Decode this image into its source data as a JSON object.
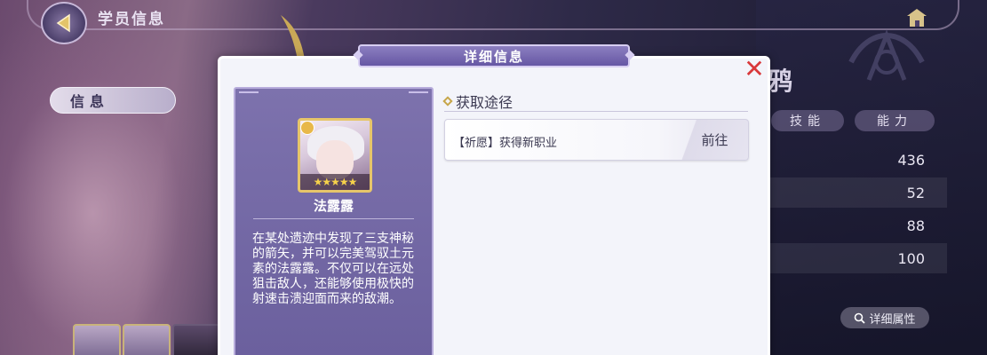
{
  "top": {
    "title": "学员信息"
  },
  "left_tab": {
    "label": "信息"
  },
  "background": {
    "crow_title": "鸦",
    "stat_tabs": [
      "技能",
      "能力"
    ],
    "stat_values": [
      "436",
      "52",
      "88",
      "100"
    ],
    "detail_attr_label": "详细属性"
  },
  "modal": {
    "header": "详细信息",
    "character": {
      "name": "法露露",
      "stars": "★★★★★",
      "description": "在某处遗迹中发现了三支神秘的箭矢，并可以完美驾驭土元素的法露露。不仅可以在远处狙击敌人，还能够使用极快的射速击溃迎面而来的敌潮。"
    },
    "source": {
      "title": "获取途径",
      "items": [
        {
          "text": "【祈愿】获得新职业",
          "action": "前往"
        }
      ]
    }
  },
  "colors": {
    "accent_purple": "#6a5f9d",
    "close_red": "#d9383a",
    "gold": "#e6c56a"
  }
}
